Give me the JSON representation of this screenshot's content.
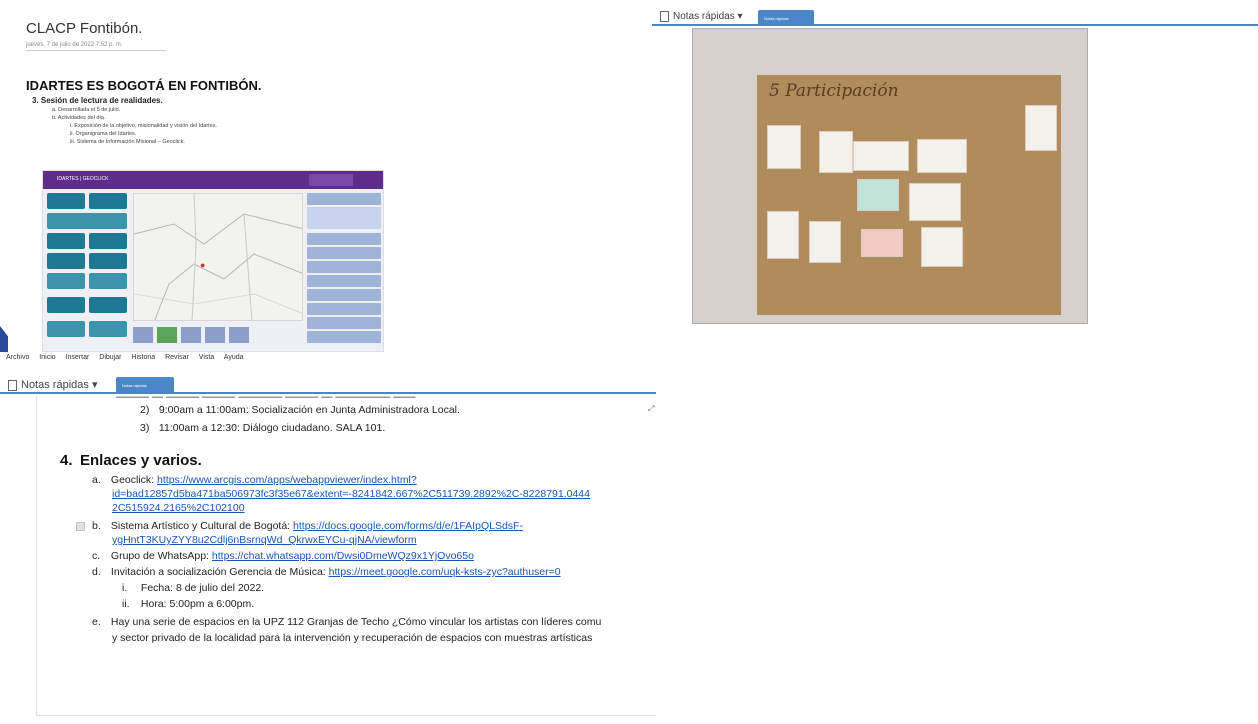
{
  "panel_a": {
    "title": "CLACP Fontibón.",
    "date": "jueves, 7 de julio de 2022   7:52 p. m.",
    "heading": "IDARTES ES BOGOTÁ EN FONTIBÓN.",
    "outline": {
      "l1": "3.  Sesión de lectura de realidades.",
      "a": "a.   Desarrollada el 5 de julio.",
      "b": "b.   Actividades del día.",
      "i": "i.    Exposición de la objetivo, misionalidad y visión del Idartes.",
      "ii": "ii.   Organigrama del Idartes.",
      "iii": "iii.  Sistema de Información Misional – Geoclick."
    },
    "slide_brand": "IDARTES | GEOCLICK"
  },
  "panel_b": {
    "notebook": "Notas rápidas",
    "section_tab": "Notas rápidas",
    "board_title": "5 Participación"
  },
  "panel_c": {
    "menu": [
      "Archivo",
      "Inicio",
      "Insertar",
      "Dibujar",
      "Historia",
      "Revisar",
      "Vista",
      "Ayuda"
    ],
    "notebook": "Notas rápidas",
    "section_tab": "Notas rápidas",
    "items": {
      "i2_mk": "2)",
      "i2": "9:00am a 11:00am: Socialización en Junta Administradora Local.",
      "i3_mk": "3)",
      "i3": "11:00am a 12:30: Diálogo ciudadano. SALA 101.",
      "heading_mk": "4.",
      "heading": "Enlaces y varios.",
      "a_mk": "a.",
      "a_text": "Geoclick: ",
      "a_link1": "https://www.arcgis.com/apps/webappviewer/index.html?",
      "a_link2": "id=bad12857d5ba471ba506973fc3f35e67&extent=-8241842.667%2C511739.2892%2C-8228791.0444",
      "a_link3": "2C515924.2165%2C102100",
      "b_mk": "b.",
      "b_text": "Sistema Artístico y Cultural de Bogotá: ",
      "b_link1": "https://docs.google.com/forms/d/e/1FAIpQLSdsF-",
      "b_link2": "ygHntT3KUyZYY8u2Cdlj6nBsrnqWd_QkrwxEYCu-qjNA/viewform",
      "c_mk": "c.",
      "c_text": "Grupo de WhatsApp: ",
      "c_link": "https://chat.whatsapp.com/Dwsi0DmeWQz9x1YjOvo65o",
      "d_mk": "d.",
      "d_text": "Invitación a socialización Gerencia de Música: ",
      "d_link": "https://meet.google.com/uqk-ksts-zyc?authuser=0",
      "di_mk": "i.",
      "di": "Fecha: 8 de julio del 2022.",
      "dii_mk": "ii.",
      "dii": "Hora: 5:00pm a 6:00pm.",
      "e_mk": "e.",
      "e1": "Hay una serie de espacios en la UPZ 112 Granjas de Techo ¿Cómo vincular los artistas con líderes comu",
      "e2": "y sector privado de la localidad para la intervención y recuperación de espacios con muestras artísticas"
    }
  },
  "colors": {
    "accent_blue": "#4a86c8",
    "link": "#1a56b5",
    "slide_header": "#5e2d8c",
    "tile": "#1e7a92"
  }
}
